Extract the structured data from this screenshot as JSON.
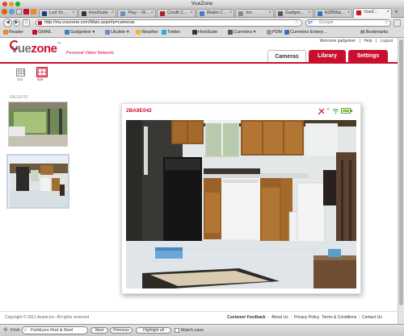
{
  "window": {
    "title": "VueZone"
  },
  "tabs": [
    {
      "label": "Led Yo…",
      "color": "#1a3d7c"
    },
    {
      "label": "HootSuite",
      "color": "#333333"
    },
    {
      "label": "Play – W…",
      "color": "#6b8ec2"
    },
    {
      "label": "Credit C…",
      "color": "#b11b2a"
    },
    {
      "label": "Wallet C…",
      "color": "#4a7bd0"
    },
    {
      "label": "ino",
      "color": "#888888"
    },
    {
      "label": "Gadget…",
      "color": "#5a5a5a"
    },
    {
      "label": "NZBMat…",
      "color": "#3b6fbf"
    },
    {
      "label": "VueZ…",
      "color": "#c8102e"
    }
  ],
  "nav": {
    "url": "http://my.vuezone.com/Main.aspx#p=cameras",
    "search_placeholder": "Google"
  },
  "bookmarks": {
    "items": [
      "Reader",
      "GMAIL",
      "Gadgeteer ▾",
      "Ukulele ▾",
      "Weather",
      "Twitter",
      "HootSuite",
      "Cummins ▾",
      "PDM",
      "Cummins Enterp…"
    ],
    "right": "Bookmarks"
  },
  "site": {
    "logo_vue": "vue",
    "logo_zone": "zone",
    "logo_tm": "™",
    "tagline": "Personal Video Network",
    "welcome": "Welcome gadgeteer",
    "help": "Help",
    "logout": "Logout",
    "tabs": {
      "cameras": "Cameras",
      "library": "Library",
      "settings": "Settings"
    },
    "accent": "#c8102e"
  },
  "left_panel": {
    "view_3x3": "3x3",
    "view_6x6": "6x6",
    "cameras": [
      {
        "id": "19E1EF42"
      },
      {
        "id": "2BA8E042"
      }
    ]
  },
  "viewer": {
    "camera_id": "2BA8E042",
    "icons": [
      "tools-icon",
      "close-icon",
      "wifi-icon",
      "battery-icon"
    ]
  },
  "footer": {
    "copyright": "Copyright © 2011 Asaek,Inc. All rights reserved",
    "links": [
      "Customer Feedback",
      "About Us",
      "Privacy Policy",
      "Terms & Conditions",
      "Contact Us"
    ]
  },
  "findbar": {
    "label": "Find:",
    "value": "FishEyes Rod & Reel",
    "next": "Next",
    "previous": "Previous",
    "highlight": "Highlight all",
    "matchcase": "Match case"
  }
}
